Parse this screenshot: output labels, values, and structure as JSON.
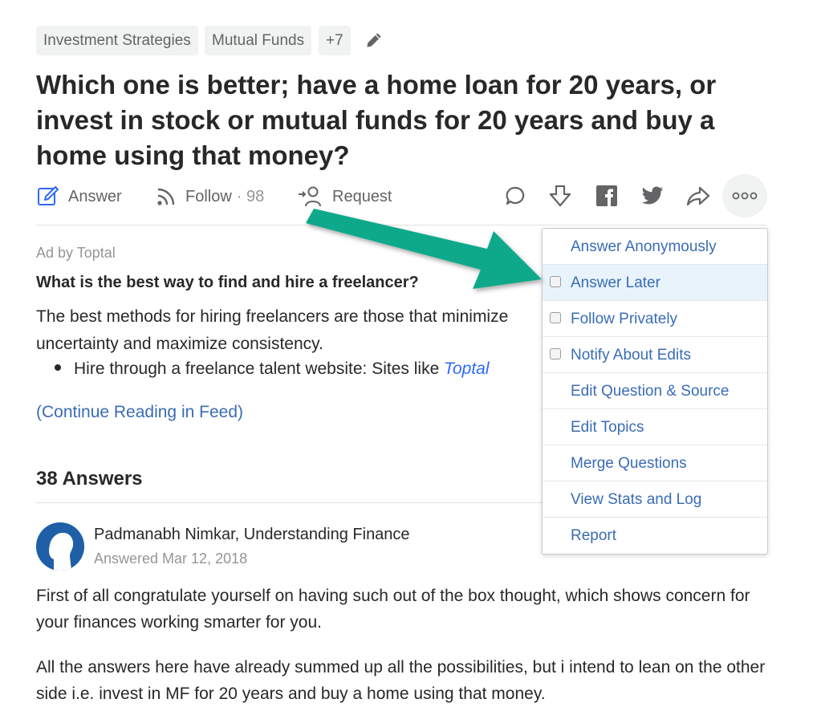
{
  "topics": {
    "chips": [
      "Investment Strategies",
      "Mutual Funds",
      "+7"
    ]
  },
  "question": {
    "title": "Which one is better; have a home loan for 20 years, or invest in stock or mutual funds for 20 years and buy a home using that money?"
  },
  "actions": {
    "answer_label": "Answer",
    "follow_label": "Follow",
    "follow_count": "· 98",
    "request_label": "Request"
  },
  "ad": {
    "label": "Ad by Toptal",
    "title": "What is the best way to find and hire a freelancer?",
    "body": "The best methods for hiring freelancers are those that minimize uncertainty and maximize consistency.",
    "bullet_prefix": "Hire through a freelance talent website: Sites like ",
    "bullet_link": "Toptal",
    "continue": "(Continue Reading in Feed)"
  },
  "answers": {
    "count_label": "38 Answers",
    "first": {
      "author": "Padmanabh Nimkar, Understanding Finance",
      "date": "Answered Mar 12, 2018",
      "para1": "First of all congratulate yourself on having such out of the box thought, which shows concern for your finances working smarter for you.",
      "para2": "All the answers here have already summed up all the possibilities, but i intend to lean on the other side i.e. invest in MF for 20 years and buy a home using that money."
    }
  },
  "menu": {
    "items": [
      {
        "label": "Answer Anonymously",
        "checkbox": false
      },
      {
        "label": "Answer Later",
        "checkbox": true
      },
      {
        "label": "Follow Privately",
        "checkbox": true
      },
      {
        "label": "Notify About Edits",
        "checkbox": true
      },
      {
        "label": "Edit Question & Source",
        "checkbox": false
      },
      {
        "label": "Edit Topics",
        "checkbox": false
      },
      {
        "label": "Merge Questions",
        "checkbox": false
      },
      {
        "label": "View Stats and Log",
        "checkbox": false
      },
      {
        "label": "Report",
        "checkbox": false
      }
    ]
  },
  "colors": {
    "link": "#3a6cb5",
    "arrow": "#0fa98a",
    "highlight": "#e8f3fb"
  }
}
